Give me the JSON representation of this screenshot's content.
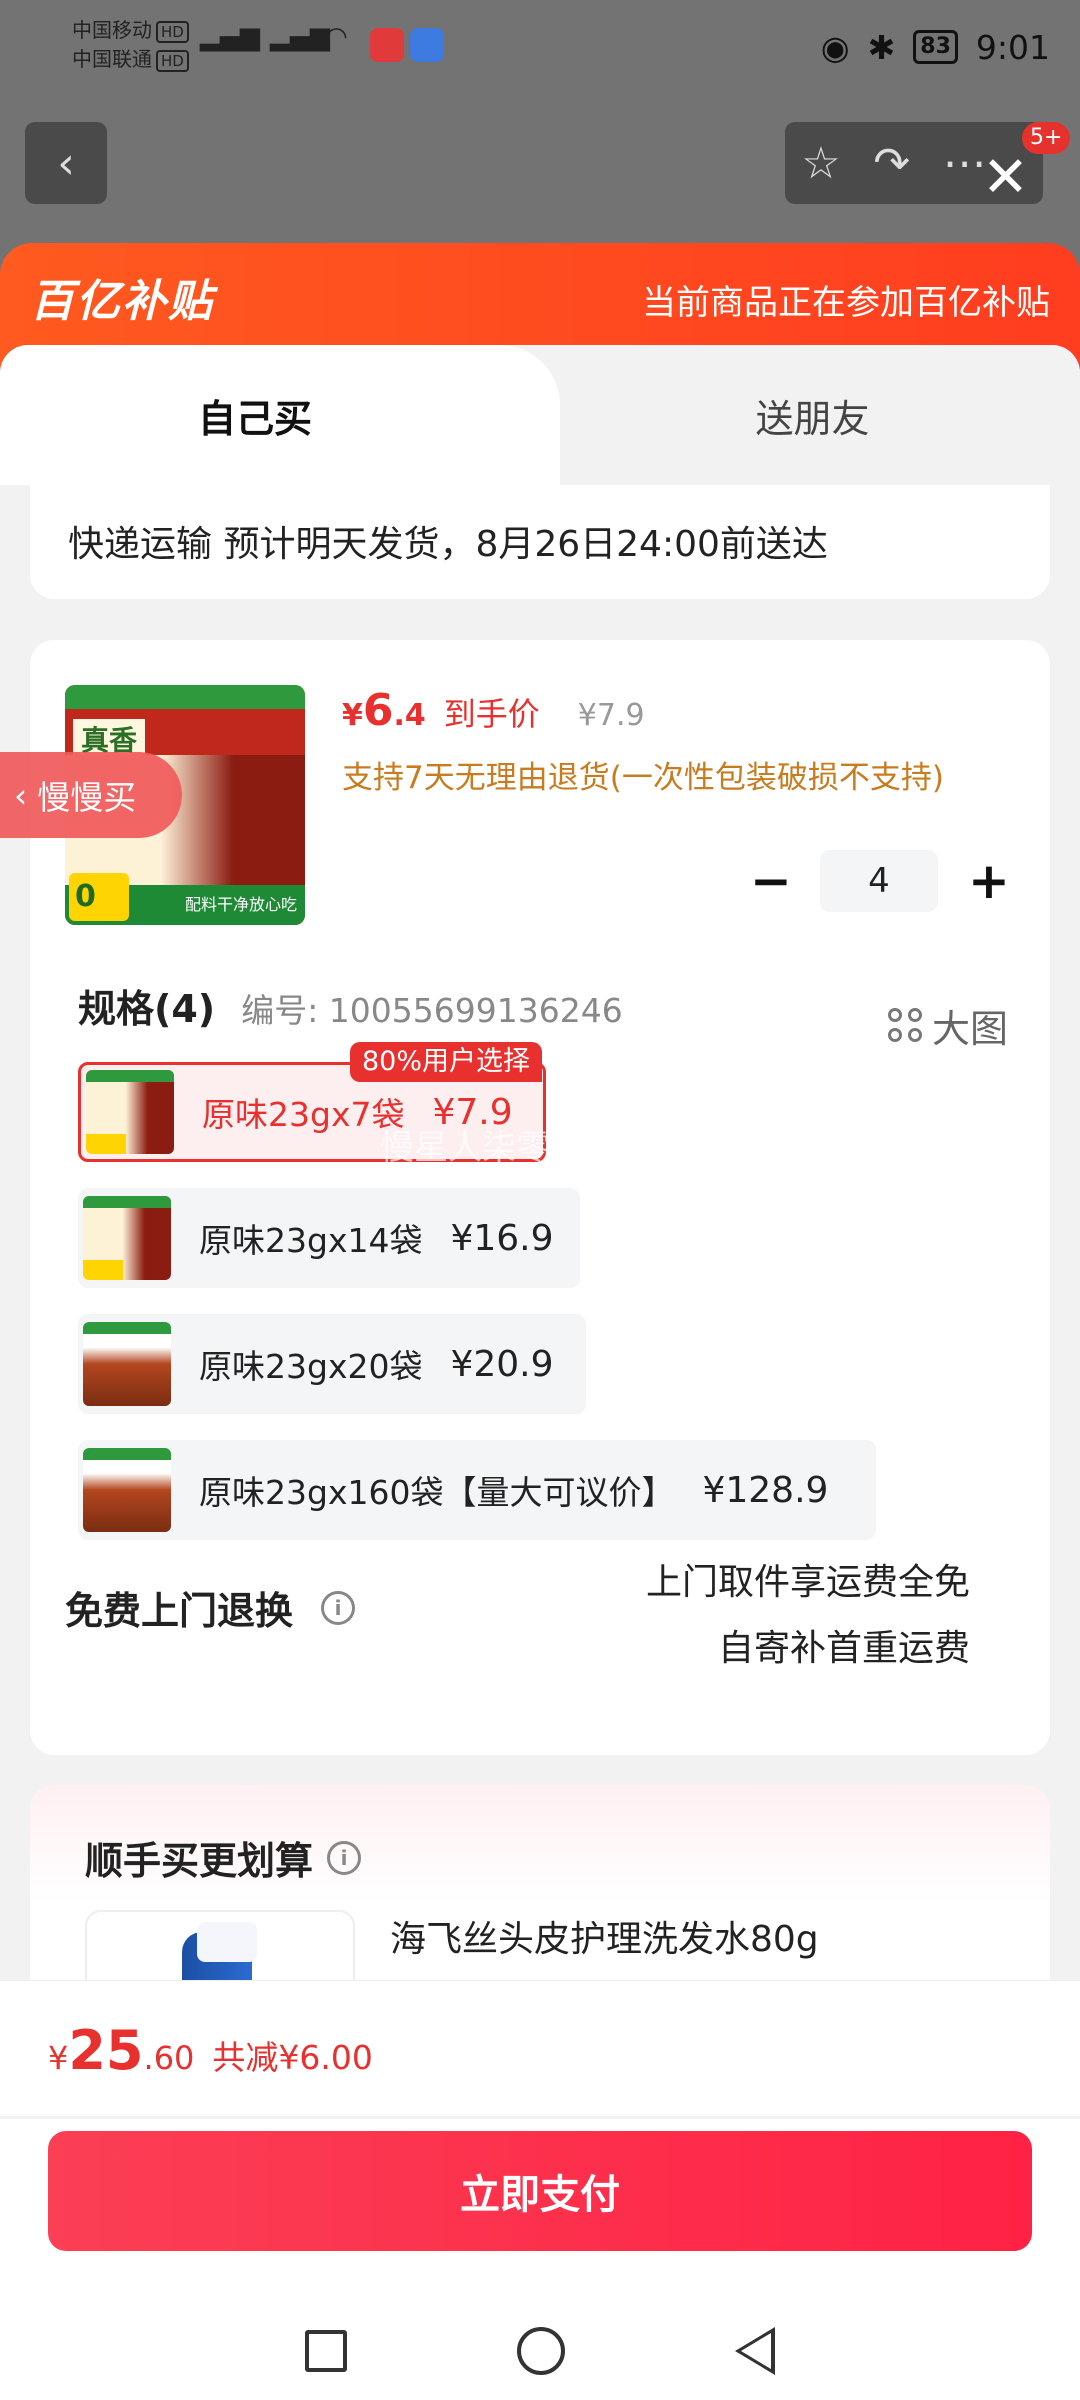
{
  "status": {
    "carrier1": "中国移动",
    "carrier2": "中国联通",
    "hd": "HD",
    "signal": "5G 4G",
    "battery": "83",
    "time": "9:01"
  },
  "topbar": {
    "back_icon": "chevron-left-icon",
    "badge": "5+"
  },
  "banner": {
    "logo": "百亿补贴",
    "text": "当前商品正在参加百亿补贴"
  },
  "tabs": [
    {
      "label": "自己买",
      "active": true
    },
    {
      "label": "送朋友",
      "active": false
    }
  ],
  "delivery": {
    "text": "快递运输 预计明天发货，8月26日24:00前送达"
  },
  "product": {
    "thumb_title": "真香",
    "thumb_zero": "0",
    "thumb_bottom": "配料干净放心吃",
    "price_symbol": "¥",
    "price_int": "6",
    "price_dec": ".4",
    "price_tag": "到手价",
    "price_old": "¥7.9",
    "return_note": "支持7天无理由退货(一次性包装破损不支持)",
    "quantity": "4",
    "minus": "−",
    "plus": "+"
  },
  "spec": {
    "title": "规格(4)",
    "code": "编号: 10055699136246",
    "big_image_label": "大图",
    "badge": "80%用户选择",
    "options": [
      {
        "label": "原味23gx7袋",
        "price": "¥7.9",
        "selected": true
      },
      {
        "label": "原味23gx14袋",
        "price": "¥16.9",
        "selected": false
      },
      {
        "label": "原味23gx20袋",
        "price": "¥20.9",
        "selected": false
      },
      {
        "label": "原味23gx160袋【量大可议价】",
        "price": "¥128.9",
        "selected": false
      }
    ]
  },
  "watermark": "慢星人柒零零",
  "free_return": {
    "title": "免费上门退换",
    "line1": "上门取件享运费全免",
    "line2": "自寄补首重运费"
  },
  "upsell": {
    "title": "顺手买更划算",
    "item_name": "海飞丝头皮护理洗发水80g"
  },
  "side_tag": {
    "label": "慢慢买"
  },
  "footer": {
    "currency": "¥",
    "total_int": "25",
    "total_dec": ".60",
    "saving": "共减¥6.00",
    "pay_label": "立即支付"
  },
  "colors": {
    "brand_orange": "#ff4a1f",
    "price_red": "#e8312f",
    "pay_button": "#ff2244"
  }
}
